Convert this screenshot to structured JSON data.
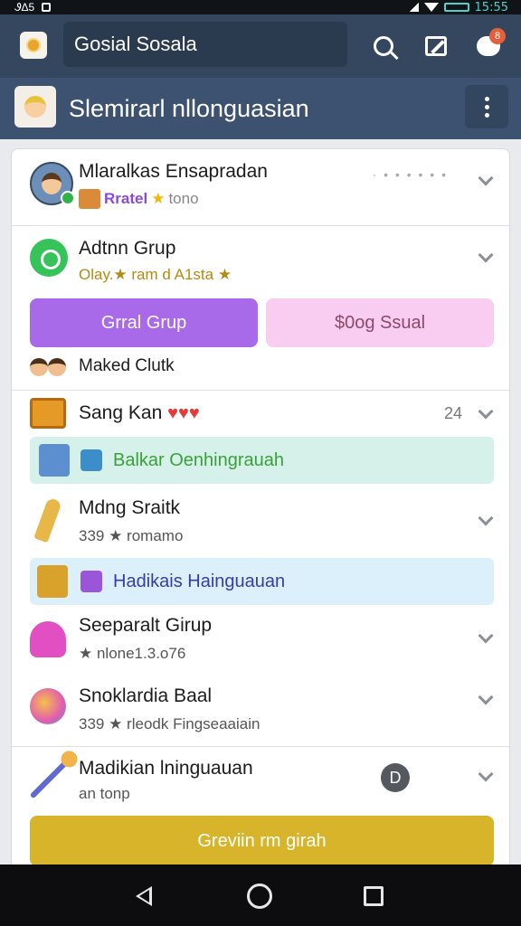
{
  "status_bar": {
    "left_text": "ᏭΔ5",
    "clock": "15:55"
  },
  "app_bar": {
    "title": "Gosial Sosala"
  },
  "group_header": {
    "title": "Slemirarl nllonguasian"
  },
  "colors": {
    "app_bar": "#34475f",
    "group_bar": "#3d5270",
    "accent_purple": "#a86ae8",
    "accent_yellow": "#d8b42a"
  },
  "items": [
    {
      "name": "Mlaralkas Ensapradan",
      "tag": "Rratel",
      "tag2": "tono",
      "icon": "avatar-icon",
      "extra": "· • • • • • •"
    },
    {
      "name": "Adtnn Grup",
      "sub": "Olay.★ ram d A1sta ★",
      "icon": "whatsapp-icon"
    },
    {
      "name": "Maked Clutk",
      "icon": "people-icon"
    },
    {
      "name": "Sang Kan",
      "count": "24",
      "icon": "crate-icon"
    },
    {
      "name": "Mdng Sraitk",
      "sub": "339 ★ romamo",
      "icon": "pencil-icon"
    },
    {
      "name": "Seeparalt Girup",
      "sub": "★ nlone1.3.o76",
      "icon": "skirt-icon"
    },
    {
      "name": "Snoklardia Baal",
      "sub": "339 ★ rleodk Fingseaaiain",
      "icon": "ball-icon"
    },
    {
      "name": "Madikian lninguauan",
      "sub": "an tonp",
      "icon": "wand-icon"
    }
  ],
  "buttons": {
    "purple": "Grral Grup",
    "pink": "$0og Ssual",
    "yellow": "Greviin rm girah"
  },
  "banners": {
    "green": "Balkar Oenhingrauah",
    "blue": "Hadikais Hainguauan"
  }
}
